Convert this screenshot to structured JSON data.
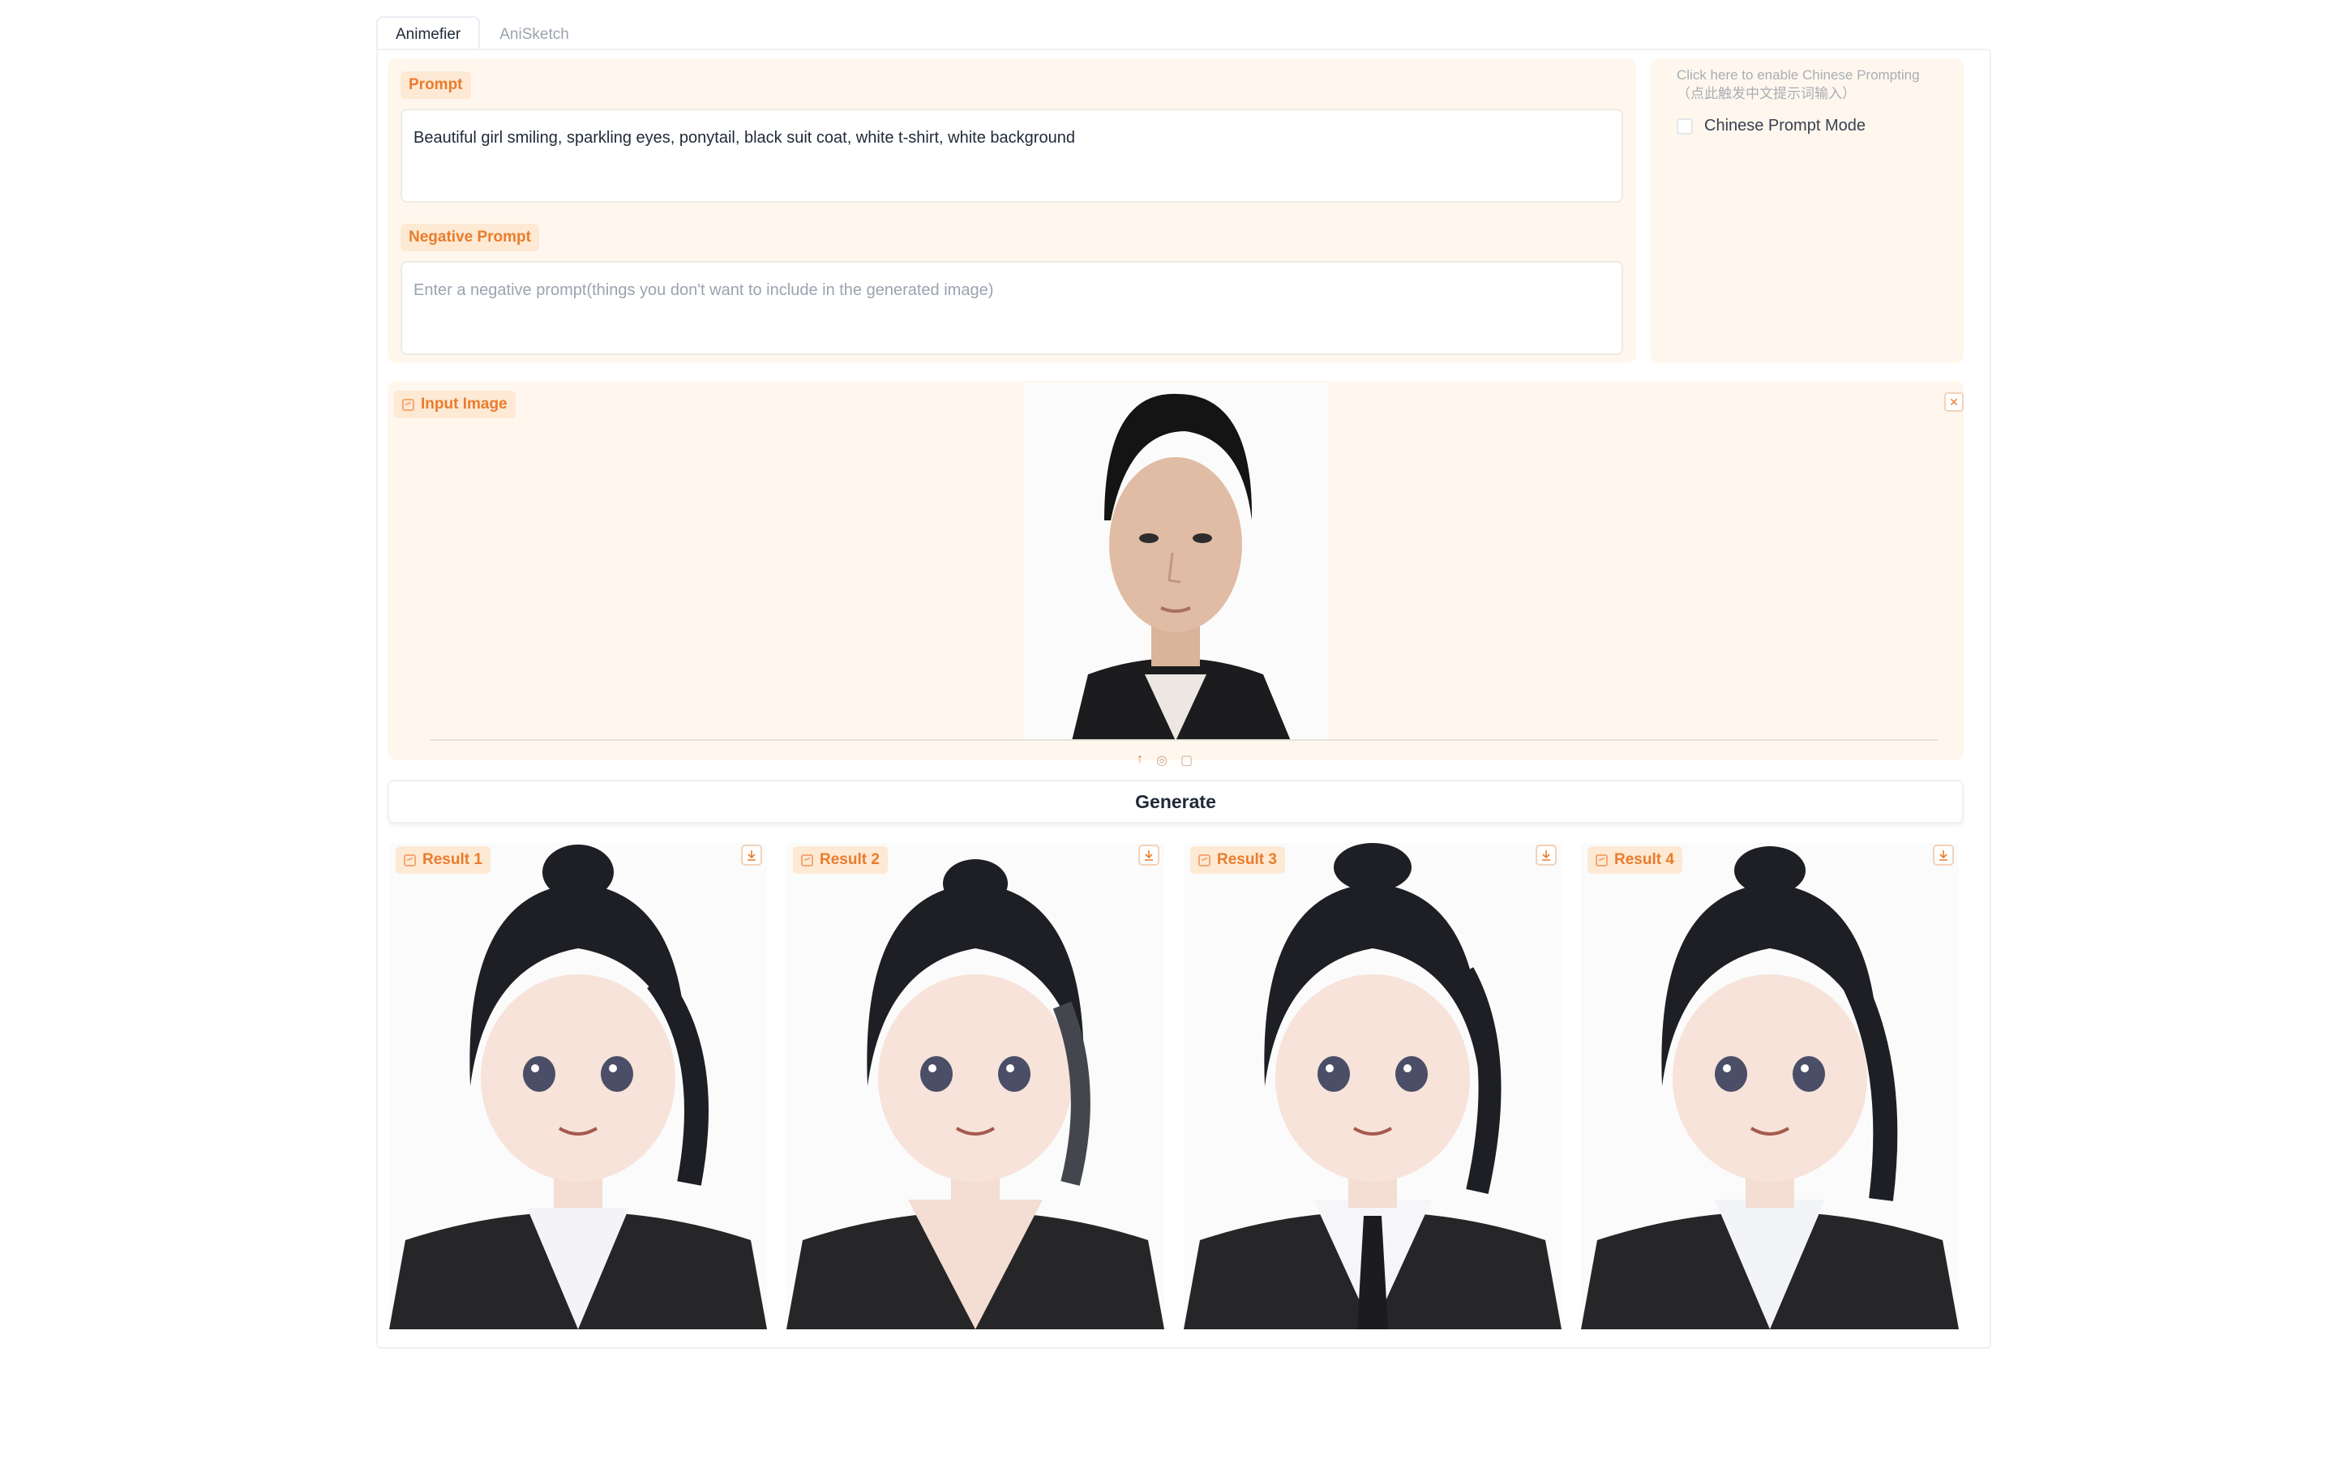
{
  "tabs": [
    {
      "label": "Animefier",
      "active": true
    },
    {
      "label": "AniSketch",
      "active": false
    }
  ],
  "prompt": {
    "label": "Prompt",
    "value": "Beautiful girl smiling, sparkling eyes, ponytail, black suit coat, white t-shirt, white background"
  },
  "negative_prompt": {
    "label": "Negative Prompt",
    "placeholder": "Enter a negative prompt(things you don't want to include in the generated image)"
  },
  "chinese": {
    "note_line1": "Click here to enable Chinese Prompting",
    "note_line2": "（点此触发中文提示词输入）",
    "checkbox_label": "Chinese Prompt Mode",
    "checked": false
  },
  "input_image": {
    "label": "Input Image"
  },
  "generate": {
    "label": "Generate"
  },
  "results": [
    {
      "label": "Result 1"
    },
    {
      "label": "Result 2"
    },
    {
      "label": "Result 3"
    },
    {
      "label": "Result 4"
    }
  ],
  "colors": {
    "accent": "#ea7c2c",
    "panel_bg": "#fff7ee",
    "badge_bg": "#fde9d4"
  }
}
